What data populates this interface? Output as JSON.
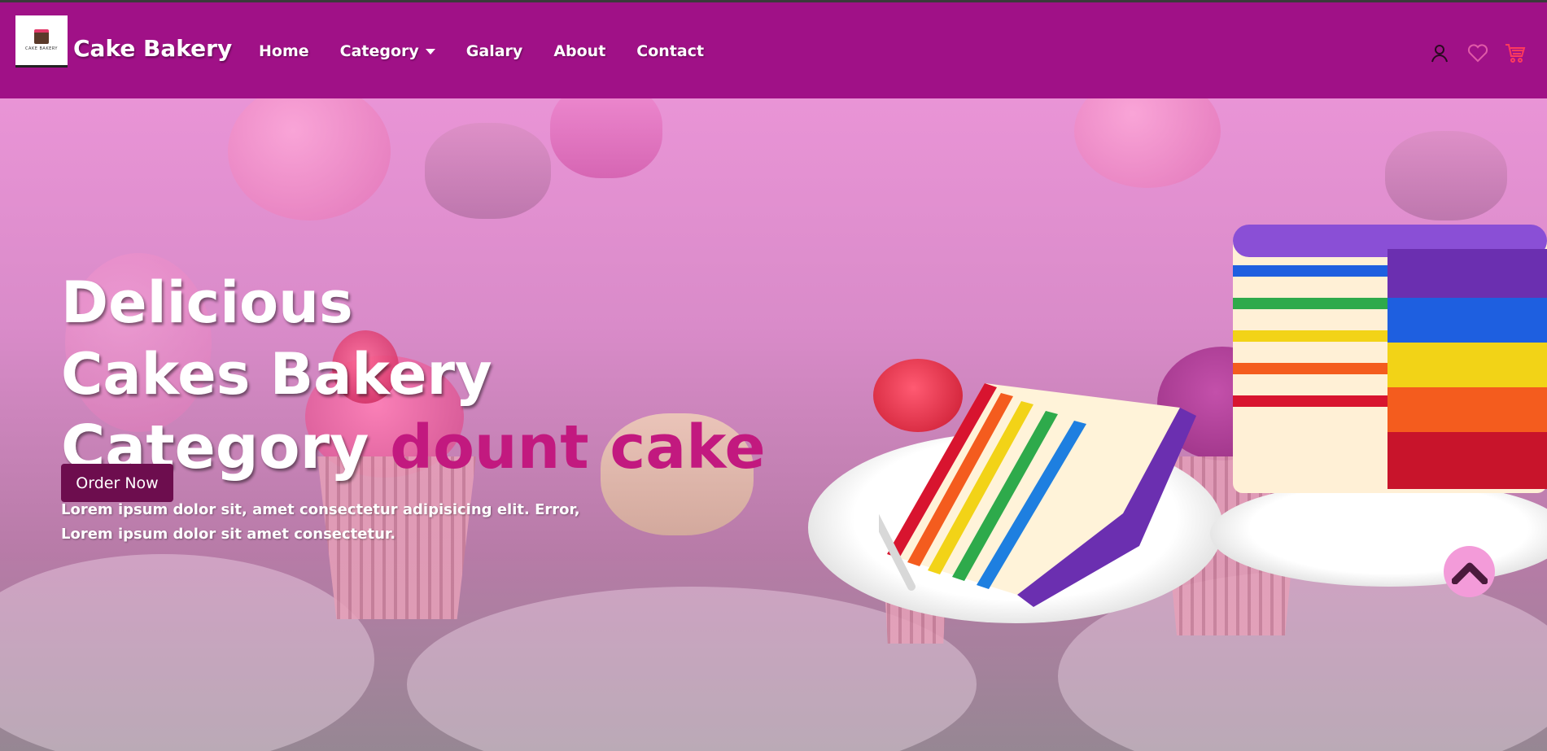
{
  "navbar": {
    "brand": "Cake Bakery",
    "logo_text": "CAKE BAKERY",
    "links": [
      {
        "label": "Home"
      },
      {
        "label": "Category",
        "has_dropdown": true
      },
      {
        "label": "Galary"
      },
      {
        "label": "About"
      },
      {
        "label": "Contact"
      }
    ],
    "icons": [
      "user-icon",
      "heart-icon",
      "cart-icon"
    ],
    "background_color": "#a01187"
  },
  "hero": {
    "title_line1": "Delicious",
    "title_line2": "Cakes Bakery",
    "title_line3_prefix": "Category ",
    "title_line3_accent": "dount cake",
    "subtitle_line1": "Lorem ipsum dolor sit, amet consectetur adipisicing elit. Error,",
    "subtitle_line2": "Lorem ipsum dolor sit amet consectetur.",
    "cta_label": "Order Now",
    "accent_color": "#c2197f",
    "cta_color": "#6d0d4e"
  },
  "scroll_top": {
    "icon": "chevron-up-icon",
    "color": "#f39bd9"
  }
}
